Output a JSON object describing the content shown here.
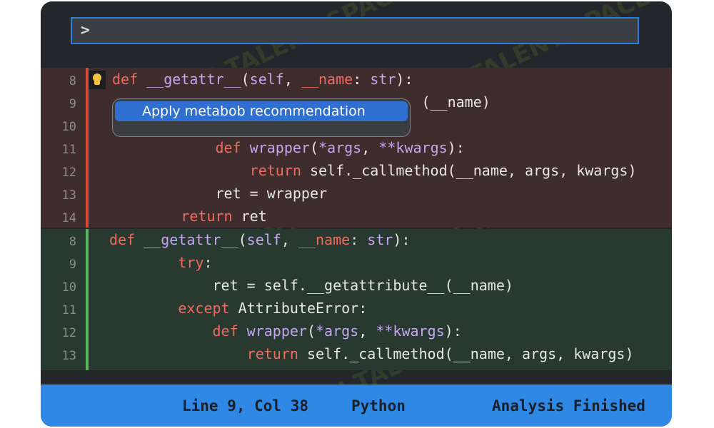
{
  "command_bar": {
    "prompt": ">",
    "value": ""
  },
  "editor": {
    "removed_block": {
      "line_numbers": [
        "8",
        "9",
        "10",
        "11",
        "12",
        "13",
        "14"
      ],
      "lines": [
        [
          {
            "t": "def ",
            "c": "kw"
          },
          {
            "t": "__getattr__",
            "c": "fn"
          },
          {
            "t": "(",
            "c": ""
          },
          {
            "t": "self",
            "c": "fn"
          },
          {
            "t": ", ",
            "c": ""
          },
          {
            "t": "__name",
            "c": "kw"
          },
          {
            "t": ": ",
            "c": ""
          },
          {
            "t": "str",
            "c": "fn"
          },
          {
            "t": "):",
            "c": ""
          }
        ],
        [
          {
            "t": "                                    (__name)",
            "c": ""
          }
        ],
        [
          {
            "t": "",
            "c": ""
          }
        ],
        [
          {
            "t": "            ",
            "c": ""
          },
          {
            "t": "def ",
            "c": "kw"
          },
          {
            "t": "wrapper",
            "c": "fn"
          },
          {
            "t": "(",
            "c": ""
          },
          {
            "t": "*args",
            "c": "fn"
          },
          {
            "t": ", ",
            "c": ""
          },
          {
            "t": "**kwargs",
            "c": "fn"
          },
          {
            "t": "):",
            "c": ""
          }
        ],
        [
          {
            "t": "                ",
            "c": ""
          },
          {
            "t": "return ",
            "c": "kw"
          },
          {
            "t": "self._callmethod(__name, args, kwargs)",
            "c": ""
          }
        ],
        [
          {
            "t": "            ret = wrapper",
            "c": ""
          }
        ],
        [
          {
            "t": "        ",
            "c": ""
          },
          {
            "t": "return ",
            "c": "kw"
          },
          {
            "t": "ret",
            "c": ""
          }
        ]
      ]
    },
    "added_block": {
      "line_numbers": [
        "8",
        "9",
        "10",
        "11",
        "12",
        "13"
      ],
      "lines": [
        [
          {
            "t": "def ",
            "c": "kw"
          },
          {
            "t": "__getattr__",
            "c": "fn"
          },
          {
            "t": "(",
            "c": ""
          },
          {
            "t": "self",
            "c": "fn"
          },
          {
            "t": ", ",
            "c": ""
          },
          {
            "t": "__name",
            "c": "kw"
          },
          {
            "t": ": ",
            "c": ""
          },
          {
            "t": "str",
            "c": "fn"
          },
          {
            "t": "):",
            "c": ""
          }
        ],
        [
          {
            "t": "        ",
            "c": ""
          },
          {
            "t": "try",
            "c": "kw"
          },
          {
            "t": ":",
            "c": ""
          }
        ],
        [
          {
            "t": "            ret = self.__getattribute__(__name)",
            "c": ""
          }
        ],
        [
          {
            "t": "        ",
            "c": ""
          },
          {
            "t": "except ",
            "c": "kw"
          },
          {
            "t": "AttributeError:",
            "c": ""
          }
        ],
        [
          {
            "t": "            ",
            "c": ""
          },
          {
            "t": "def ",
            "c": "kw"
          },
          {
            "t": "wrapper",
            "c": "fn"
          },
          {
            "t": "(",
            "c": ""
          },
          {
            "t": "*args",
            "c": "fn"
          },
          {
            "t": ", ",
            "c": ""
          },
          {
            "t": "**kwargs",
            "c": "fn"
          },
          {
            "t": "):",
            "c": ""
          }
        ],
        [
          {
            "t": "                ",
            "c": ""
          },
          {
            "t": "return ",
            "c": "kw"
          },
          {
            "t": "self._callmethod(__name, args, kwargs)",
            "c": ""
          }
        ]
      ]
    }
  },
  "popup": {
    "action_label": "Apply metabob recommendation"
  },
  "status_bar": {
    "position": "Line 9, Col 38",
    "language": "Python",
    "analysis": "Analysis Finished"
  },
  "watermark": {
    "text": "AI TALENT SPACE"
  },
  "colors": {
    "keyword": "#ef6b5f",
    "identifier": "#c6a5f0",
    "removed_bg": "#3e2d2c",
    "added_bg": "#283a30",
    "accent": "#2f88e6"
  },
  "icons": {
    "hint": "lightbulb-icon"
  }
}
